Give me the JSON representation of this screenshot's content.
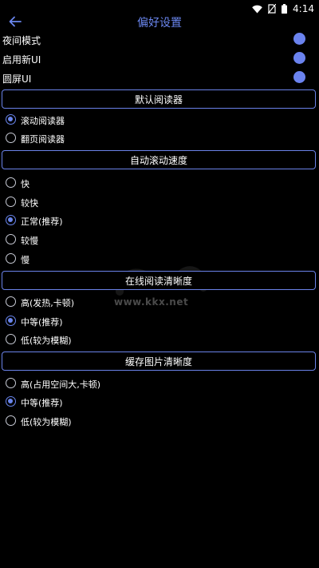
{
  "status_bar": {
    "time": "4:14"
  },
  "header": {
    "title": "偏好设置"
  },
  "toggles": [
    {
      "label": "夜间模式",
      "on": true
    },
    {
      "label": "启用新UI",
      "on": true
    },
    {
      "label": "圆屏UI",
      "on": true
    }
  ],
  "sections": {
    "reader": {
      "title": "默认阅读器",
      "options": [
        {
          "label": "滚动阅读器",
          "checked": true
        },
        {
          "label": "翻页阅读器",
          "checked": false
        }
      ]
    },
    "scroll_speed": {
      "title": "自动滚动速度",
      "options": [
        {
          "label": "快",
          "checked": false
        },
        {
          "label": "较快",
          "checked": false
        },
        {
          "label": "正常(推荐)",
          "checked": true
        },
        {
          "label": "较慢",
          "checked": false
        },
        {
          "label": "慢",
          "checked": false
        }
      ]
    },
    "online_clarity": {
      "title": "在线阅读清晰度",
      "options": [
        {
          "label": "高(发热,卡顿)",
          "checked": false
        },
        {
          "label": "中等(推荐)",
          "checked": true
        },
        {
          "label": "低(较为模糊)",
          "checked": false
        }
      ]
    },
    "cache_clarity": {
      "title": "缓存图片清晰度",
      "options": [
        {
          "label": "高(占用空间大,卡顿)",
          "checked": false
        },
        {
          "label": "中等(推荐)",
          "checked": true
        },
        {
          "label": "低(较为模糊)",
          "checked": false
        }
      ]
    }
  },
  "watermark": {
    "text": "www.kkx.net"
  },
  "colors": {
    "accent": "#6a86ee",
    "background": "#000000"
  }
}
